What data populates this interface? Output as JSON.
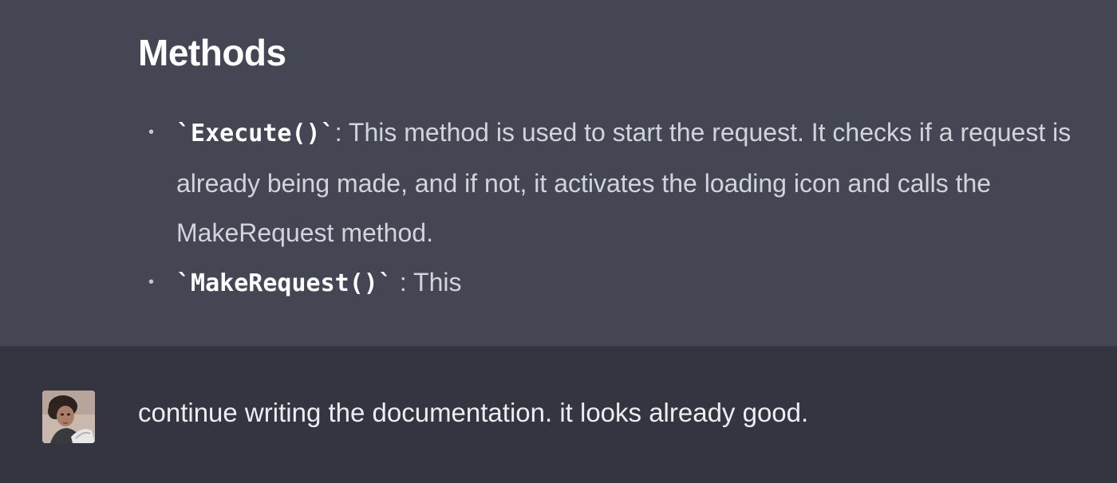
{
  "assistant_message": {
    "heading": "Methods",
    "items": [
      {
        "code": "`Execute()`",
        "text": ": This method is used to start the request. It checks if a request is already being made, and if not, it activates the loading icon and calls the MakeRequest method."
      },
      {
        "code": "`MakeRequest()`",
        "text": " : This"
      }
    ]
  },
  "user_message": {
    "avatar_icon": "user-photo-avatar",
    "text": "continue writing the documentation. it looks already good."
  },
  "colors": {
    "assistant_bg": "#444654",
    "user_bg": "#343541",
    "heading": "#ffffff",
    "body_text": "#d1d5db"
  }
}
